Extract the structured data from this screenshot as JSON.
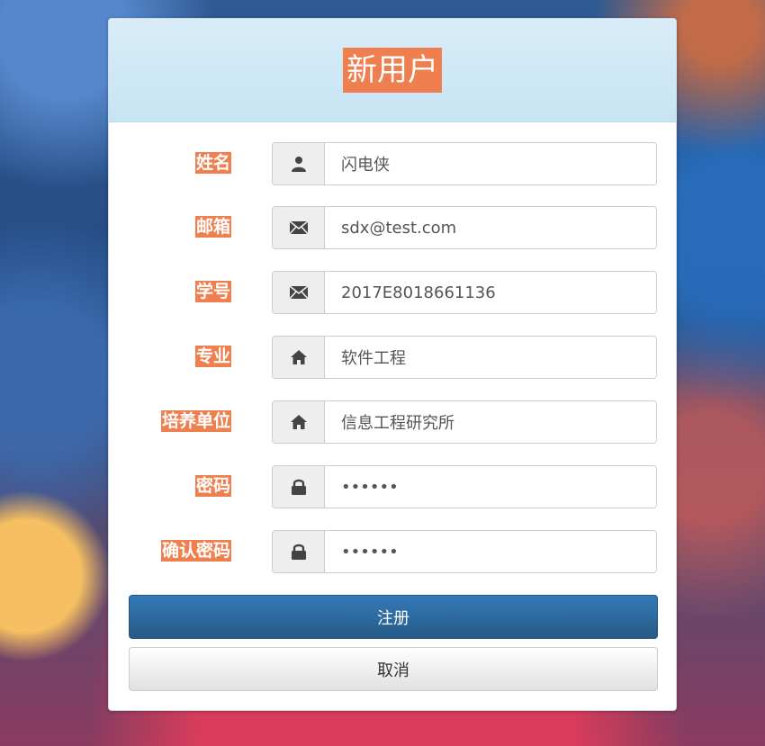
{
  "form": {
    "title": "新用户",
    "fields": [
      {
        "label": "姓名",
        "icon": "user-icon",
        "value": "闪电侠",
        "type": "text"
      },
      {
        "label": "邮箱",
        "icon": "envelope-icon",
        "value": "sdx@test.com",
        "type": "text"
      },
      {
        "label": "学号",
        "icon": "envelope-icon",
        "value": "2017E8018661136",
        "type": "text"
      },
      {
        "label": "专业",
        "icon": "home-icon",
        "value": "软件工程",
        "type": "text"
      },
      {
        "label": "培养单位",
        "icon": "home-icon",
        "value": "信息工程研究所",
        "type": "text"
      },
      {
        "label": "密码",
        "icon": "lock-icon",
        "value": "••••••",
        "type": "password"
      },
      {
        "label": "确认密码",
        "icon": "lock-icon",
        "value": "••••••",
        "type": "password"
      }
    ],
    "submit_label": "注册",
    "cancel_label": "取消"
  },
  "colors": {
    "label_highlight": "#f07f4f",
    "header_bg": "#d9edf8",
    "primary_button": "#2d6aa5"
  }
}
